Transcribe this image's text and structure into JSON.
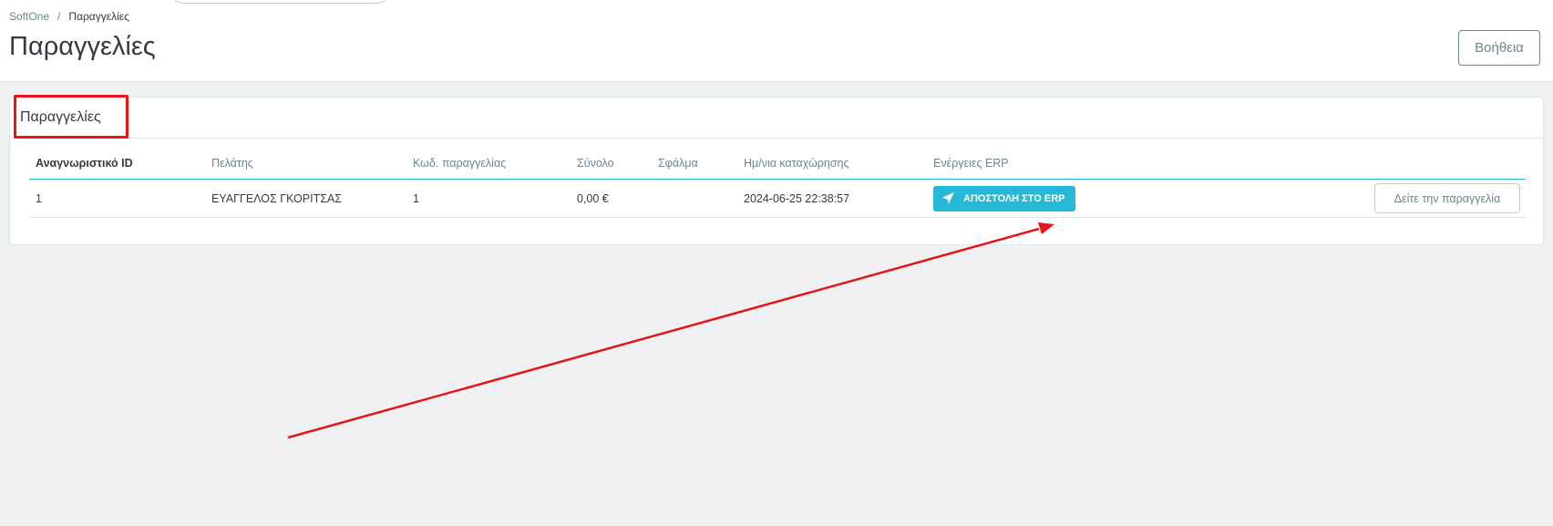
{
  "breadcrumb": {
    "parent": "SoftOne",
    "separator": "/",
    "current": "Παραγγελίες"
  },
  "header": {
    "title": "Παραγγελίες",
    "help_label": "Βοήθεια"
  },
  "card": {
    "title": "Παραγγελίες"
  },
  "table": {
    "columns": [
      "Αναγνωριστικό ID",
      "Πελάτης",
      "Κωδ. παραγγελίας",
      "Σύνολο",
      "Σφάλμα",
      "Ημ/νια καταχώρησης",
      "Ενέργειες ERP"
    ],
    "rows": [
      {
        "id": "1",
        "customer": "ΕΥΑΓΓΕΛΟΣ ΓΚΟΡΙΤΣΑΣ",
        "order_code": "1",
        "total": "0,00 €",
        "error": "",
        "date": "2024-06-25 22:38:57",
        "erp_action": "ΑΠΟΣΤΟΛΗ ΣΤΟ ERP",
        "view_label": "Δείτε την παραγγελία"
      }
    ]
  },
  "colors": {
    "accent": "#25b9d7",
    "annotation": "#e81418"
  },
  "icons": {
    "erp_button": "paper-plane-icon"
  }
}
